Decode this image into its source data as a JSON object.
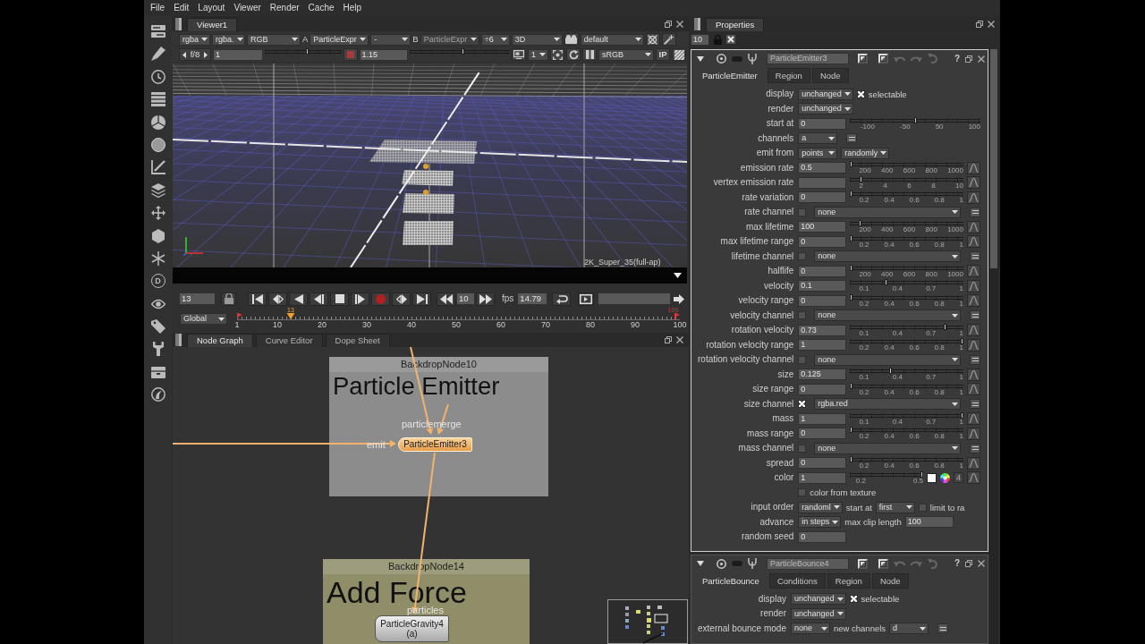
{
  "menu_bar": [
    "File",
    "Edit",
    "Layout",
    "Viewer",
    "Render",
    "Cache",
    "Help"
  ],
  "left_toolbar": {
    "letter_button": "D"
  },
  "viewer": {
    "tab": {
      "label": "Viewer1",
      "selected": true
    },
    "toolbar_1": [
      {
        "kind": "dropdown",
        "value": "rgba",
        "disabled": false
      },
      {
        "kind": "dropdown",
        "value": "rgba.",
        "disabled": false
      },
      {
        "kind": "dropdown",
        "value": "RGB",
        "disabled": false
      },
      {
        "kind": "label",
        "text": "A"
      },
      {
        "kind": "dropdown",
        "value": "ParticleExpr",
        "disabled": false
      },
      {
        "kind": "dropdown",
        "value": "-",
        "disabled": false
      },
      {
        "kind": "label",
        "text": "B"
      },
      {
        "kind": "dropdown",
        "value": "ParticleExpr",
        "disabled": true
      },
      {
        "kind": "dropdown",
        "value": "÷6",
        "disabled": false
      },
      {
        "kind": "dropdown",
        "value": "3D",
        "disabled": false
      },
      {
        "kind": "button"
      },
      {
        "kind": "dropdown",
        "value": "default",
        "disabled": false
      },
      {
        "kind": "button"
      },
      {
        "kind": "button"
      }
    ],
    "toolbar_2": [
      {
        "kind": "stepper",
        "value": "f/8"
      },
      {
        "kind": "field",
        "value": "1"
      },
      {
        "kind": "slider",
        "level": 0.56
      },
      {
        "kind": "button"
      },
      {
        "kind": "field",
        "value": "1.15"
      },
      {
        "kind": "slider",
        "level": 0.53
      },
      {
        "kind": "button"
      },
      {
        "kind": "dropdown",
        "value": "1",
        "disabled": false
      },
      {
        "kind": "button"
      },
      {
        "kind": "button"
      },
      {
        "kind": "button"
      },
      {
        "kind": "dropdown",
        "value": "sRGB",
        "disabled": false
      },
      {
        "kind": "text_button",
        "text": "IP"
      },
      {
        "kind": "button"
      }
    ],
    "format_label": "2K_Super_35(full-ap)",
    "playback": {
      "frame": "13",
      "increment": "10",
      "fps_label": "fps",
      "fps": "14.79"
    },
    "timeline": {
      "range": "Global",
      "ticks": [
        "1",
        "10",
        "20",
        "30",
        "40",
        "50",
        "60",
        "70",
        "80",
        "90",
        "100"
      ],
      "playhead": {
        "label": "13",
        "level": 0.121
      },
      "out_label": "100"
    }
  },
  "node_graph": {
    "tabs": [
      {
        "label": "Node Graph",
        "selected": true
      },
      {
        "label": "Curve Editor",
        "selected": false
      },
      {
        "label": "Dope Sheet",
        "selected": false
      }
    ],
    "backdrops": [
      {
        "title": "BackdropNode10",
        "heading": "Particle Emitter",
        "color": "#8c8c8c"
      },
      {
        "title": "BackdropNode14",
        "heading": "Add Force",
        "color": "#8f8e69"
      }
    ],
    "nodes": [
      {
        "name": "ParticleEmitter3",
        "selected": true,
        "inputs": [
          "particlemerge",
          "emit"
        ]
      },
      {
        "name": "ParticleGravity4",
        "subtitle": "(a)",
        "selected": false,
        "inputs": [
          "particles"
        ]
      }
    ]
  },
  "properties": {
    "tab": {
      "label": "Properties",
      "selected": true
    },
    "max_panels": "10",
    "panels": [
      {
        "name": "ParticleEmitter3",
        "selected": true,
        "expanded": true,
        "help": "?",
        "tabs": [
          {
            "label": "ParticleEmitter",
            "selected": true
          },
          {
            "label": "Region",
            "selected": false
          },
          {
            "label": "Node",
            "selected": false
          }
        ],
        "knobs": [
          {
            "label": "display",
            "widgets": [
              {
                "kind": "dropdown",
                "value": "unchanged"
              },
              {
                "kind": "checkbox",
                "checked": true,
                "text": "selectable"
              }
            ]
          },
          {
            "label": "render",
            "widgets": [
              {
                "kind": "dropdown",
                "value": "unchanged"
              }
            ]
          },
          {
            "label": "start at",
            "widgets": [
              {
                "kind": "field",
                "value": "0"
              },
              {
                "kind": "slider",
                "level": 0.5,
                "ticks": [
                  "-100",
                  "-50",
                  "50",
                  "100"
                ]
              }
            ]
          },
          {
            "label": "channels",
            "widgets": [
              {
                "kind": "dropdown",
                "value": "a"
              },
              {
                "kind": "menu_button"
              }
            ]
          },
          {
            "label": "emit from",
            "widgets": [
              {
                "kind": "dropdown",
                "value": "points"
              },
              {
                "kind": "dropdown",
                "value": "randomly"
              }
            ]
          },
          {
            "label": "emission rate",
            "widgets": [
              {
                "kind": "field",
                "value": "0.5"
              },
              {
                "kind": "slider",
                "level": 0,
                "ticks": [
                  "200",
                  "400",
                  "600",
                  "800",
                  "1000"
                ]
              },
              {
                "kind": "curve_button"
              }
            ]
          },
          {
            "label": "vertex emission rate",
            "widgets": [
              {
                "kind": "field"
              },
              {
                "kind": "slider",
                "level": 0.09,
                "ticks": [
                  "2",
                  "4",
                  "6",
                  "8",
                  "10"
                ]
              },
              {
                "kind": "curve_button"
              }
            ]
          },
          {
            "label": "rate variation",
            "widgets": [
              {
                "kind": "field",
                "value": "0"
              },
              {
                "kind": "slider",
                "level": 0,
                "ticks": [
                  "0.2",
                  "0.4",
                  "0.6",
                  "0.8",
                  "1"
                ]
              },
              {
                "kind": "curve_button"
              }
            ]
          },
          {
            "label": "rate channel",
            "widgets": [
              {
                "kind": "checkbox",
                "checked": false
              },
              {
                "kind": "channel_menu",
                "value": "none"
              },
              {
                "kind": "menu_button"
              }
            ]
          },
          {
            "label": "max lifetime",
            "widgets": [
              {
                "kind": "field",
                "value": "100"
              },
              {
                "kind": "slider",
                "level": 0.08,
                "ticks": [
                  "200",
                  "400",
                  "600",
                  "800",
                  "1000"
                ]
              },
              {
                "kind": "curve_button"
              }
            ]
          },
          {
            "label": "max lifetime range",
            "widgets": [
              {
                "kind": "field",
                "value": "0"
              },
              {
                "kind": "slider",
                "level": 0,
                "ticks": [
                  "0.2",
                  "0.4",
                  "0.6",
                  "0.8",
                  "1"
                ]
              },
              {
                "kind": "curve_button"
              }
            ]
          },
          {
            "label": "lifetime channel",
            "widgets": [
              {
                "kind": "checkbox",
                "checked": false
              },
              {
                "kind": "channel_menu",
                "value": "none"
              },
              {
                "kind": "menu_button"
              }
            ]
          },
          {
            "label": "halflife",
            "widgets": [
              {
                "kind": "field",
                "value": "0"
              },
              {
                "kind": "slider",
                "level": 0,
                "ticks": [
                  "200",
                  "400",
                  "600",
                  "800",
                  "1000"
                ]
              },
              {
                "kind": "curve_button"
              }
            ]
          },
          {
            "label": "velocity",
            "widgets": [
              {
                "kind": "field",
                "value": "0.1"
              },
              {
                "kind": "slider",
                "level": 0.31,
                "ticks": [
                  "0.1",
                  "0.4",
                  "0.7",
                  "1"
                ]
              },
              {
                "kind": "curve_button"
              }
            ]
          },
          {
            "label": "velocity range",
            "widgets": [
              {
                "kind": "field",
                "value": "0"
              },
              {
                "kind": "slider",
                "level": 0,
                "ticks": [
                  "0.2",
                  "0.4",
                  "0.6",
                  "0.8",
                  "1"
                ]
              },
              {
                "kind": "curve_button"
              }
            ]
          },
          {
            "label": "velocity channel",
            "widgets": [
              {
                "kind": "checkbox",
                "checked": false
              },
              {
                "kind": "channel_menu",
                "value": "none"
              },
              {
                "kind": "menu_button"
              }
            ]
          },
          {
            "label": "rotation velocity",
            "widgets": [
              {
                "kind": "field",
                "value": "0.73"
              },
              {
                "kind": "slider",
                "level": 0.85,
                "ticks": [
                  "0.1",
                  "0.4",
                  "0.7",
                  "1"
                ]
              },
              {
                "kind": "curve_button"
              }
            ]
          },
          {
            "label": "rotation velocity range",
            "widgets": [
              {
                "kind": "field",
                "value": "1"
              },
              {
                "kind": "slider",
                "level": 1,
                "ticks": [
                  "0.2",
                  "0.4",
                  "0.6",
                  "0.8",
                  "1"
                ]
              },
              {
                "kind": "curve_button"
              }
            ]
          },
          {
            "label": "rotation velocity channel",
            "widgets": [
              {
                "kind": "checkbox",
                "checked": false
              },
              {
                "kind": "channel_menu",
                "value": "none"
              },
              {
                "kind": "menu_button"
              }
            ]
          },
          {
            "label": "size",
            "widgets": [
              {
                "kind": "field",
                "value": "0.125"
              },
              {
                "kind": "slider",
                "level": 0.35,
                "ticks": [
                  "0.1",
                  "0.4",
                  "0.7",
                  "1"
                ]
              },
              {
                "kind": "curve_button"
              }
            ]
          },
          {
            "label": "size range",
            "widgets": [
              {
                "kind": "field",
                "value": "0"
              },
              {
                "kind": "slider",
                "level": 0,
                "ticks": [
                  "0.2",
                  "0.4",
                  "0.6",
                  "0.8",
                  "1"
                ]
              },
              {
                "kind": "curve_button"
              }
            ]
          },
          {
            "label": "size channel",
            "widgets": [
              {
                "kind": "checkbox",
                "checked": true
              },
              {
                "kind": "channel_menu",
                "value": "rgba.red"
              },
              {
                "kind": "menu_button"
              }
            ]
          },
          {
            "label": "mass",
            "widgets": [
              {
                "kind": "field",
                "value": "1"
              },
              {
                "kind": "slider",
                "level": 1,
                "ticks": [
                  "0.1",
                  "0.4",
                  "0.7",
                  "1"
                ]
              },
              {
                "kind": "curve_button"
              }
            ]
          },
          {
            "label": "mass range",
            "widgets": [
              {
                "kind": "field",
                "value": "0"
              },
              {
                "kind": "slider",
                "level": 0,
                "ticks": [
                  "0.2",
                  "0.4",
                  "0.6",
                  "0.8",
                  "1"
                ]
              },
              {
                "kind": "curve_button"
              }
            ]
          },
          {
            "label": "mass channel",
            "widgets": [
              {
                "kind": "checkbox",
                "checked": false
              },
              {
                "kind": "channel_menu",
                "value": "none"
              },
              {
                "kind": "menu_button"
              }
            ]
          },
          {
            "label": "spread",
            "widgets": [
              {
                "kind": "field",
                "value": "0"
              },
              {
                "kind": "slider",
                "level": 0,
                "ticks": [
                  "0.2",
                  "0.4",
                  "0.6",
                  "0.8",
                  "1"
                ]
              },
              {
                "kind": "curve_button"
              }
            ]
          },
          {
            "label": "color",
            "widgets": [
              {
                "kind": "field",
                "value": "1"
              },
              {
                "kind": "slider",
                "level": 1,
                "ticks": [
                  "0.2",
                  "0.5"
                ]
              },
              {
                "kind": "swatch"
              },
              {
                "kind": "color_wheel"
              },
              {
                "kind": "count_button",
                "text": "4"
              },
              {
                "kind": "curve_button"
              }
            ]
          },
          {
            "widgets": [
              {
                "kind": "checkbox",
                "checked": false,
                "text": "color from texture"
              }
            ]
          },
          {
            "label": "input order",
            "widgets": [
              {
                "kind": "dropdown",
                "value": "randoml"
              },
              {
                "kind": "label",
                "text": "start at"
              },
              {
                "kind": "dropdown",
                "value": "first"
              },
              {
                "kind": "checkbox",
                "checked": false,
                "text": "limit to ra"
              }
            ]
          },
          {
            "label": "advance",
            "widgets": [
              {
                "kind": "dropdown",
                "value": "in steps"
              },
              {
                "kind": "label",
                "text": "max clip length"
              },
              {
                "kind": "field",
                "value": "100"
              }
            ]
          },
          {
            "label": "random seed",
            "widgets": [
              {
                "kind": "field",
                "value": "0"
              }
            ]
          }
        ]
      },
      {
        "name": "ParticleBounce4",
        "selected": false,
        "expanded": true,
        "help": "?",
        "tabs": [
          {
            "label": "ParticleBounce",
            "selected": true
          },
          {
            "label": "Conditions",
            "selected": false
          },
          {
            "label": "Region",
            "selected": false
          },
          {
            "label": "Node",
            "selected": false
          }
        ],
        "knobs": [
          {
            "label": "display",
            "widgets": [
              {
                "kind": "dropdown",
                "value": "unchanged"
              },
              {
                "kind": "checkbox",
                "checked": true,
                "text": "selectable"
              }
            ]
          },
          {
            "label": "render",
            "widgets": [
              {
                "kind": "dropdown",
                "value": "unchanged"
              }
            ]
          },
          {
            "label": "external bounce mode",
            "widgets": [
              {
                "kind": "dropdown",
                "value": "none"
              },
              {
                "kind": "label",
                "text": "new channels"
              },
              {
                "kind": "dropdown",
                "value": "d"
              },
              {
                "kind": "menu_button"
              }
            ]
          }
        ]
      }
    ]
  }
}
